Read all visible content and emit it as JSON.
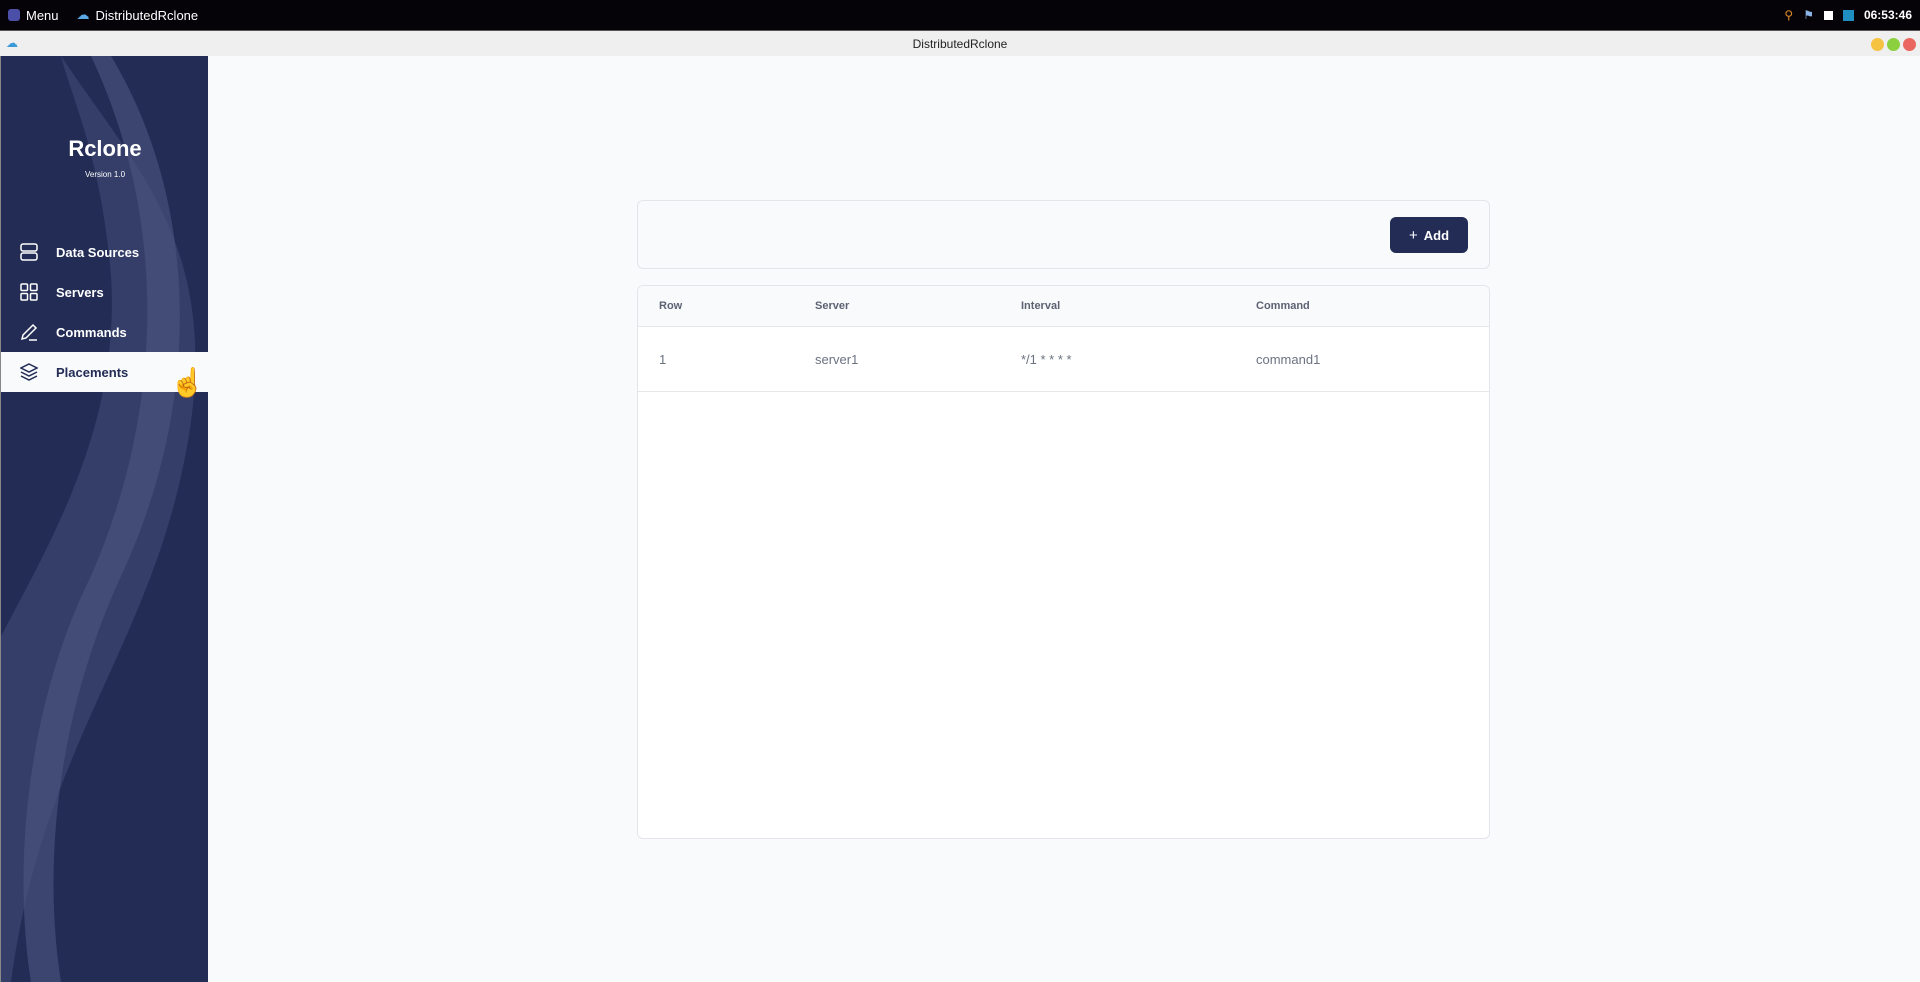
{
  "system_bar": {
    "menu_label": "Menu",
    "app_label": "DistributedRclone",
    "clock": "06:53:46"
  },
  "window": {
    "title": "DistributedRclone"
  },
  "sidebar": {
    "brand": "Rclone",
    "version": "Version 1.0",
    "items": [
      {
        "label": "Data Sources"
      },
      {
        "label": "Servers"
      },
      {
        "label": "Commands"
      },
      {
        "label": "Placements"
      }
    ]
  },
  "toolbar": {
    "add_label": "Add"
  },
  "table": {
    "columns": [
      "Row",
      "Server",
      "Interval",
      "Command"
    ],
    "rows": [
      [
        "1",
        "server1",
        "*/1 * * * *",
        "command1"
      ]
    ]
  },
  "colors": {
    "sidebar": "#222c55",
    "accent": "#222c55",
    "background": "#f9fafc"
  }
}
